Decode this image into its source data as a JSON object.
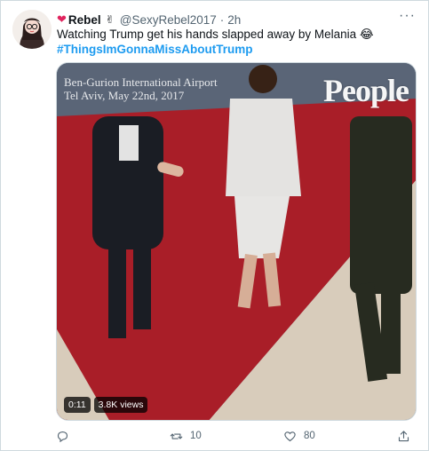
{
  "tweet": {
    "display_name": "Rebel",
    "name_prefix_emoji": "❤",
    "name_suffix_emoji": "✌",
    "handle": "@SexyRebel2017",
    "separator": "·",
    "timestamp": "2h",
    "more_label": "···",
    "text": "Watching Trump get his hands slapped away by Melania 😂",
    "hashtag": "#ThingsImGonnaMissAboutTrump"
  },
  "media": {
    "caption_line1": "Ben-Gurion International Airport",
    "caption_line2": "Tel Aviv, May 22nd, 2017",
    "brand": "People",
    "duration": "0:11",
    "views": "3.8K views"
  },
  "actions": {
    "reply_count": "",
    "retweet_count": "10",
    "like_count": "80",
    "share_count": ""
  },
  "icons": {
    "reply": "comment-icon",
    "retweet": "retweet-icon",
    "like": "heart-icon",
    "share": "share-icon",
    "more": "more-icon"
  },
  "colors": {
    "accent": "#1d9bf0",
    "heart": "#e0245e",
    "muted": "#536471",
    "carpet": "#b3202b"
  }
}
